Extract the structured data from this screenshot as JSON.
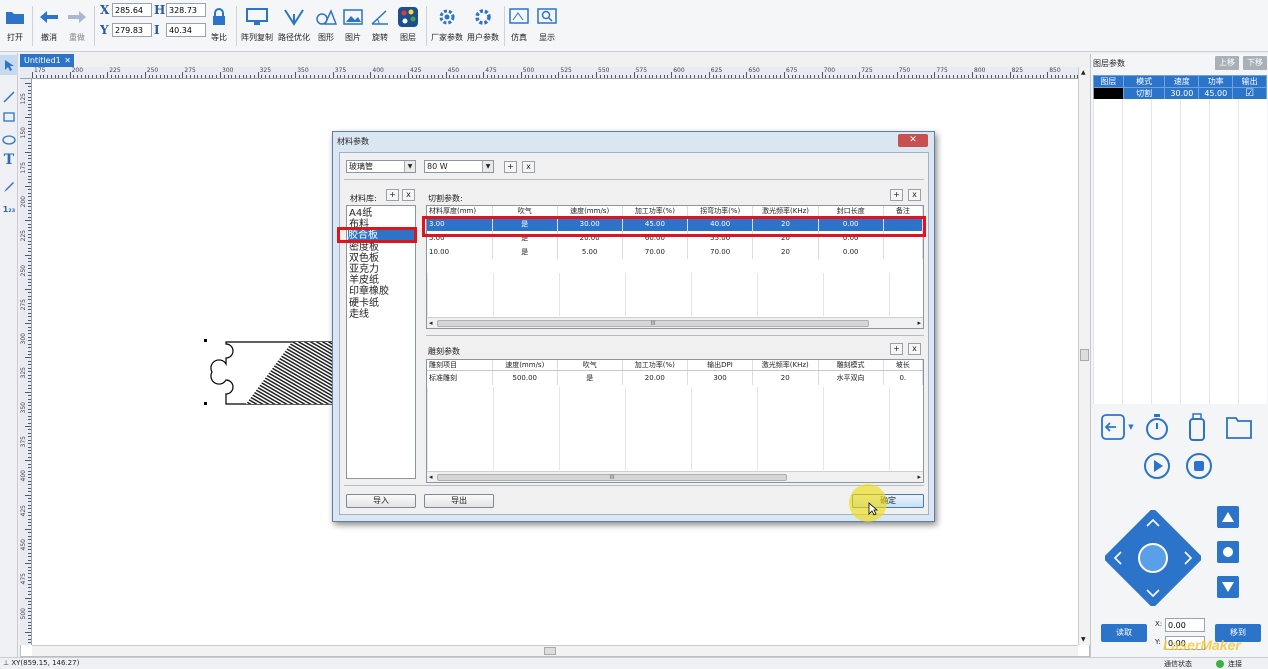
{
  "toolbar": {
    "open": "打开",
    "undo": "撤消",
    "redo": "重做",
    "x_label": "X",
    "x_value": "285.64",
    "h_label": "H",
    "h_value": "328.73",
    "y_label": "Y",
    "y_value": "279.83",
    "w_label": "I",
    "w_value": "40.34",
    "ratio": "等比",
    "array_copy": "阵列复制",
    "path_opt": "路径优化",
    "shape": "图形",
    "image": "图片",
    "rotate": "旋转",
    "layer": "图层",
    "factory_params": "厂家参数",
    "user_params": "用户参数",
    "simulate": "仿真",
    "display": "显示"
  },
  "left_tools": {
    "text_tool": "T",
    "number_tool": "1₂₃"
  },
  "document": {
    "tab_label": "Untitled1",
    "ruler_h": [
      "175",
      "200",
      "225",
      "250",
      "275",
      "300",
      "325",
      "350",
      "375",
      "400",
      "425",
      "450",
      "475",
      "500",
      "525",
      "550",
      "575",
      "600",
      "625",
      "650",
      "675",
      "700",
      "725",
      "750",
      "775",
      "800",
      "825",
      "850"
    ],
    "ruler_v": [
      "125",
      "150",
      "175",
      "200",
      "225",
      "250",
      "275",
      "300",
      "325",
      "350",
      "375",
      "400",
      "425",
      "450",
      "475",
      "500"
    ]
  },
  "layer_panel": {
    "title": "图层参数",
    "move_up": "上移",
    "move_down": "下移",
    "columns": [
      "图层",
      "模式",
      "速度",
      "功率",
      "输出"
    ],
    "row": {
      "mode": "切割",
      "speed": "30.00",
      "power": "45.00",
      "output": "☑",
      "color": "#000000"
    }
  },
  "controls": {
    "read": "读取",
    "move_to": "移到",
    "x_label": "X:",
    "x_value": "0.00",
    "y_label": "Y:",
    "y_value": "0.00",
    "watermark": "LaserMaker"
  },
  "status": {
    "coords": "XY(859.15, 146.27)",
    "comm_status": "通信状态",
    "connection": "连接"
  },
  "dialog": {
    "title": "材料参数",
    "close": "✕",
    "material_type": "玻璃管",
    "power_select": "80 W",
    "library_label": "材料库:",
    "materials": [
      "A4纸",
      "布料",
      "胶合板",
      "密度板",
      "双色板",
      "亚克力",
      "羊皮纸",
      "印章橡胶",
      "硬卡纸",
      "走线"
    ],
    "selected_material": 2,
    "cut": {
      "label": "切割参数:",
      "columns": [
        "材料厚度(mm)",
        "吹气",
        "速度(mm/s)",
        "加工功率(%)",
        "拐弯功率(%)",
        "激光频率(KHz)",
        "封口长度",
        "备注"
      ],
      "rows": [
        [
          "3.00",
          "是",
          "30.00",
          "45.00",
          "40.00",
          "20",
          "0.00",
          ""
        ],
        [
          "5.00",
          "是",
          "20.00",
          "60.00",
          "55.00",
          "20",
          "0.00",
          ""
        ],
        [
          "10.00",
          "是",
          "5.00",
          "70.00",
          "70.00",
          "20",
          "0.00",
          ""
        ]
      ],
      "selected_row": 0
    },
    "engrave": {
      "label": "雕刻参数",
      "columns": [
        "雕刻项目",
        "速度(mm/s)",
        "吹气",
        "加工功率(%)",
        "输出DPI",
        "激光频率(KHz)",
        "雕刻模式",
        "坡长"
      ],
      "rows": [
        [
          "标准雕刻",
          "500.00",
          "是",
          "20.00",
          "300",
          "20",
          "水平双向",
          "0."
        ]
      ]
    },
    "import": "导入",
    "export": "导出",
    "ok": "确定",
    "scroll_thumb": "III"
  },
  "colors": {
    "accent": "#2c74c9",
    "highlight": "#e0141c"
  }
}
